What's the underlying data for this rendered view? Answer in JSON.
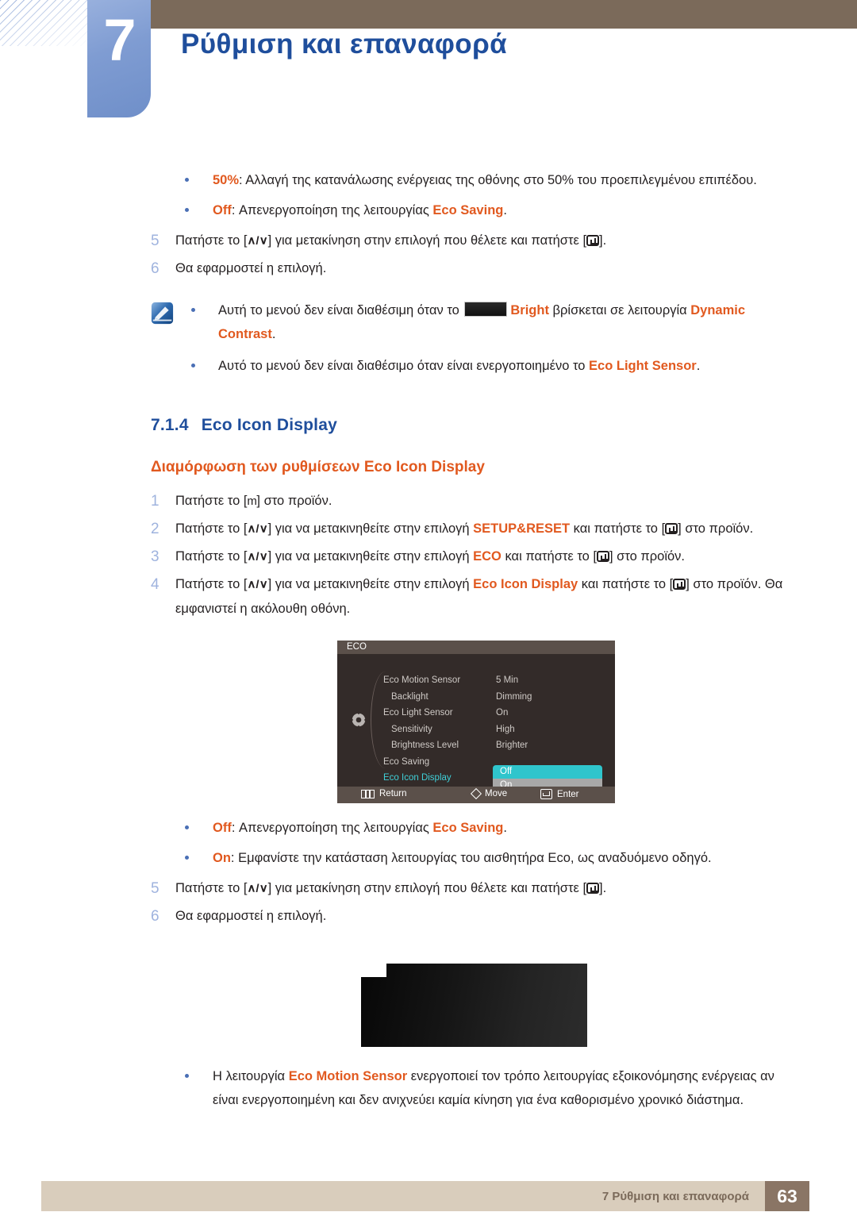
{
  "header": {
    "chapter_number": "7",
    "chapter_title": "Ρύθμιση και επαναφορά"
  },
  "top_bullets": [
    {
      "label": "50%",
      "label_color": "#e1591f",
      "text_before": "",
      "text": ": Αλλαγή της κατανάλωσης ενέργειας της οθόνης στο 50% του προεπιλεγμένου επιπέδου."
    },
    {
      "label": "Off",
      "label_color": "#e1591f",
      "text": ": Απενεργοποίηση της λειτουργίας ",
      "emphasis": "Eco Saving",
      "text_after": "."
    }
  ],
  "top_steps": [
    {
      "num": "5",
      "part1": "Πατήστε το [",
      "key": "∧/∨",
      "part2": "] για μετακίνηση στην επιλογή που θέλετε και πατήστε [",
      "part3": "]."
    },
    {
      "num": "6",
      "part1": "Θα εφαρμοστεί η επιλογή.",
      "key": "",
      "part2": "",
      "part3": ""
    }
  ],
  "note": {
    "icon": "note-pencil-icon",
    "bullets": [
      {
        "part1": "Αυτή το μενού δεν είναι διαθέσιμη όταν το ",
        "redacted": true,
        "emph1": "Bright",
        "part2": " βρίσκεται σε λειτουργία ",
        "emph2": "Dynamic Contrast",
        "part3": "."
      },
      {
        "part1": "Αυτό το μενού δεν είναι διαθέσιμο όταν είναι ενεργοποιημένο το ",
        "redacted": false,
        "emph1": "",
        "part2": "",
        "emph2": "Eco Light Sensor",
        "part3": "."
      }
    ]
  },
  "section": {
    "number": "7.1.4",
    "title": "Eco Icon Display",
    "subtitle": "Διαμόρφωση των ρυθμίσεων Eco Icon Display"
  },
  "steps": [
    {
      "num": "1",
      "part1": "Πατήστε το [",
      "key": "m",
      "part2": "] στο προϊόν.",
      "emph": "",
      "part3": "",
      "part4": ""
    },
    {
      "num": "2",
      "part1": "Πατήστε το [",
      "key": "∧/∨",
      "part2": "] για να μετακινηθείτε στην επιλογή ",
      "emph": "SETUP&RESET",
      "part3": " και πατήστε το [",
      "part4": "] στο προϊόν."
    },
    {
      "num": "3",
      "part1": "Πατήστε το [",
      "key": "∧/∨",
      "part2": "] για να μετακινηθείτε στην επιλογή ",
      "emph": "ECO",
      "part3": " και πατήστε το [",
      "part4": "] στο προϊόν."
    },
    {
      "num": "4",
      "part1": "Πατήστε το [",
      "key": "∧/∨",
      "part2": "] για να μετακινηθείτε στην επιλογή ",
      "emph": "Eco Icon Display",
      "part3": " και πατήστε το [",
      "part4": "] στο προϊόν. Θα εμφανιστεί η ακόλουθη οθόνη."
    }
  ],
  "osd": {
    "title": "ECO",
    "menu_rows": [
      {
        "label": "Eco Motion Sensor",
        "value": "5 Min",
        "indent": false,
        "active": false
      },
      {
        "label": "Backlight",
        "value": "Dimming",
        "indent": true,
        "active": false
      },
      {
        "label": "Eco Light Sensor",
        "value": "On",
        "indent": false,
        "active": false
      },
      {
        "label": "Sensitivity",
        "value": "High",
        "indent": true,
        "active": false
      },
      {
        "label": "Brightness Level",
        "value": "Brighter",
        "indent": true,
        "active": false
      },
      {
        "label": "Eco Saving",
        "value": "",
        "indent": false,
        "active": false
      },
      {
        "label": "Eco Icon Display",
        "value": "",
        "indent": false,
        "active": true
      }
    ],
    "popup": {
      "selected": "Off",
      "unselected": "On"
    },
    "footer": [
      {
        "icon": "return-icon",
        "label": "Return"
      },
      {
        "icon": "move-diamond-icon",
        "label": "Move"
      },
      {
        "icon": "enter-icon",
        "label": "Enter"
      }
    ],
    "highlight_color": "#2fc5cc",
    "active_text_color": "#3fd0d8"
  },
  "bottom_bullets": [
    {
      "label": "Off",
      "text": ": Απενεργοποίηση της λειτουργίας ",
      "emphasis": "Eco Saving",
      "text_after": "."
    },
    {
      "label": "On",
      "text": ": Εμφανίστε την κατάσταση λειτουργίας του αισθητήρα Eco, ως αναδυόμενο οδηγό.",
      "emphasis": "",
      "text_after": ""
    }
  ],
  "bottom_steps": [
    {
      "num": "5",
      "part1": "Πατήστε το [",
      "key": "∧/∨",
      "part2": "] για μετακίνηση στην επιλογή που θέλετε και πατήστε [",
      "part3": "]."
    },
    {
      "num": "6",
      "part1": "Θα εφαρμοστεί η επιλογή.",
      "key": "",
      "part2": "",
      "part3": ""
    }
  ],
  "final_bullet": {
    "part1": "Η λειτουργία ",
    "emph": "Eco Motion Sensor",
    "part2": " ενεργοποιεί τον τρόπο λειτουργίας εξοικονόμησης ενέργειας αν είναι ενεργοποιημένη και δεν ανιχνεύει καμία κίνηση για ένα καθορισμένο χρονικό διάστημα."
  },
  "footer": {
    "text": "7 Ρύθμιση και επαναφορά",
    "page": "63",
    "bar_color": "#d9cdbc",
    "page_box_color": "#8a7565"
  }
}
